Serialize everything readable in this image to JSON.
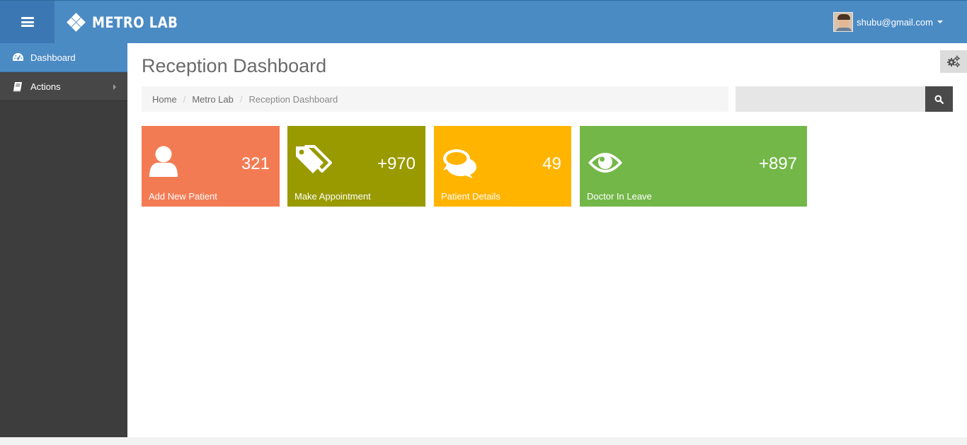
{
  "app": {
    "brand": "METRO LAB"
  },
  "user": {
    "email": "shubu@gmail.com"
  },
  "sidebar": {
    "items": [
      {
        "label": "Dashboard",
        "icon": "dashboard-icon",
        "active": true
      },
      {
        "label": "Actions",
        "icon": "book-icon",
        "has_submenu": true
      }
    ]
  },
  "page": {
    "title": "Reception Dashboard"
  },
  "breadcrumb": [
    "Home",
    "Metro Lab",
    "Reception Dashboard"
  ],
  "search": {
    "placeholder": "",
    "value": ""
  },
  "tiles": [
    {
      "label": "Add New Patient",
      "count": "321",
      "icon": "user-icon",
      "color": "#f37b53"
    },
    {
      "label": "Make Appointment",
      "count": "+970",
      "icon": "tags-icon",
      "color": "#999a00"
    },
    {
      "label": "Patient Details",
      "count": "49",
      "icon": "comments-icon",
      "color": "#ffb400"
    },
    {
      "label": "Doctor In Leave",
      "count": "+897",
      "icon": "eye-icon",
      "color": "#74b749"
    }
  ],
  "colors": {
    "header": "#4b8bc4",
    "header_dark": "#3b78b3",
    "sidebar": "#3d3d3d"
  }
}
